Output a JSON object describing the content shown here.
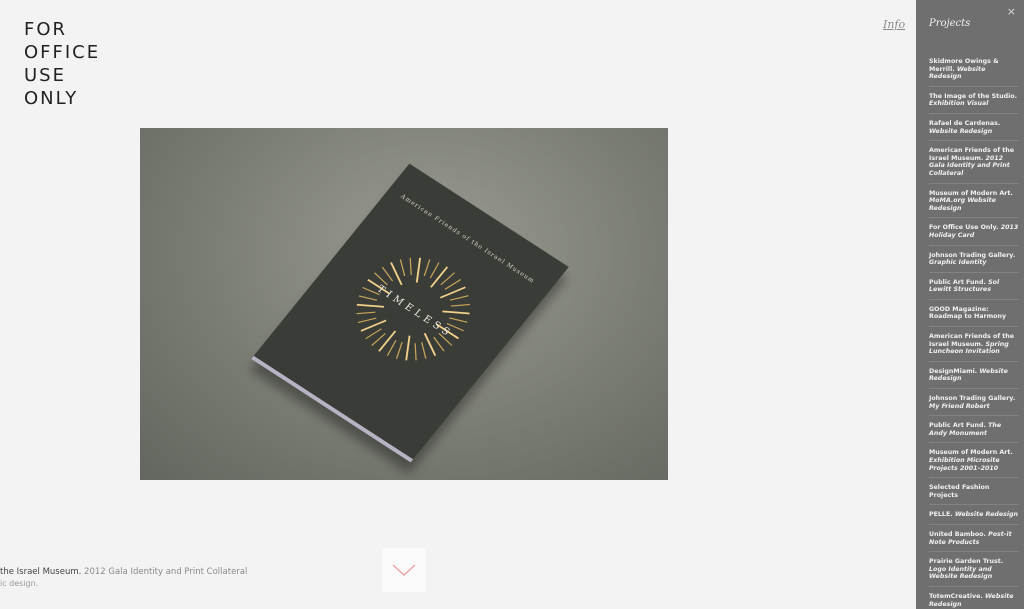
{
  "logo": {
    "lines": [
      "FOR",
      "OFFICE",
      "USE",
      "ONLY"
    ]
  },
  "nav": {
    "info_label": "Info"
  },
  "sidebar": {
    "close_glyph": "×",
    "title": "Projects",
    "projects": [
      {
        "name": "Skidmore Owings & Merrill.",
        "sub": "Website Redesign"
      },
      {
        "name": "The Image of the Studio.",
        "sub": "Exhibition Visual"
      },
      {
        "name": "Rafael de Cardenas.",
        "sub": "Website Redesign"
      },
      {
        "name": "American Friends of the Israel Museum.",
        "sub": "2012 Gala Identity and Print Collateral"
      },
      {
        "name": "Museum of Modern Art.",
        "sub": "MoMA.org Website Redesign"
      },
      {
        "name": "For Office Use Only.",
        "sub": "2013 Holiday Card"
      },
      {
        "name": "Johnson Trading Gallery.",
        "sub": "Graphic Identity"
      },
      {
        "name": "Public Art Fund.",
        "sub": "Sol Lewitt Structures"
      },
      {
        "name": "GOOD Magazine: Roadmap to Harmony",
        "sub": ""
      },
      {
        "name": "American Friends of the Israel Museum.",
        "sub": "Spring Luncheon Invitation"
      },
      {
        "name": "DesignMiami.",
        "sub": "Website Redesign"
      },
      {
        "name": "Johnson Trading Gallery.",
        "sub": "My Friend Robert"
      },
      {
        "name": "Public Art Fund.",
        "sub": "The Andy Monument"
      },
      {
        "name": "Museum of Modern Art.",
        "sub": "Exhibition Microsite Projects 2001–2010"
      },
      {
        "name": "Selected Fashion Projects",
        "sub": ""
      },
      {
        "name": "PELLE.",
        "sub": "Website Redesign"
      },
      {
        "name": "United Bamboo.",
        "sub": "Post-it Note Products"
      },
      {
        "name": "Prairie Garden Trust.",
        "sub": "Logo Identity and Website Redesign"
      },
      {
        "name": "TotemCreative.",
        "sub": "Website Redesign"
      }
    ]
  },
  "photo": {
    "book_header": "American Friends of the Israel Museum",
    "book_title": "TIMELESS"
  },
  "caption": {
    "title_part": "the Israel Museum.",
    "sub_part": "2012 Gala Identity and Print Collateral",
    "line2": "ic design."
  },
  "colors": {
    "sidebar_bg": "#6f6f6f",
    "down_arrow": "#e8a6a6"
  }
}
